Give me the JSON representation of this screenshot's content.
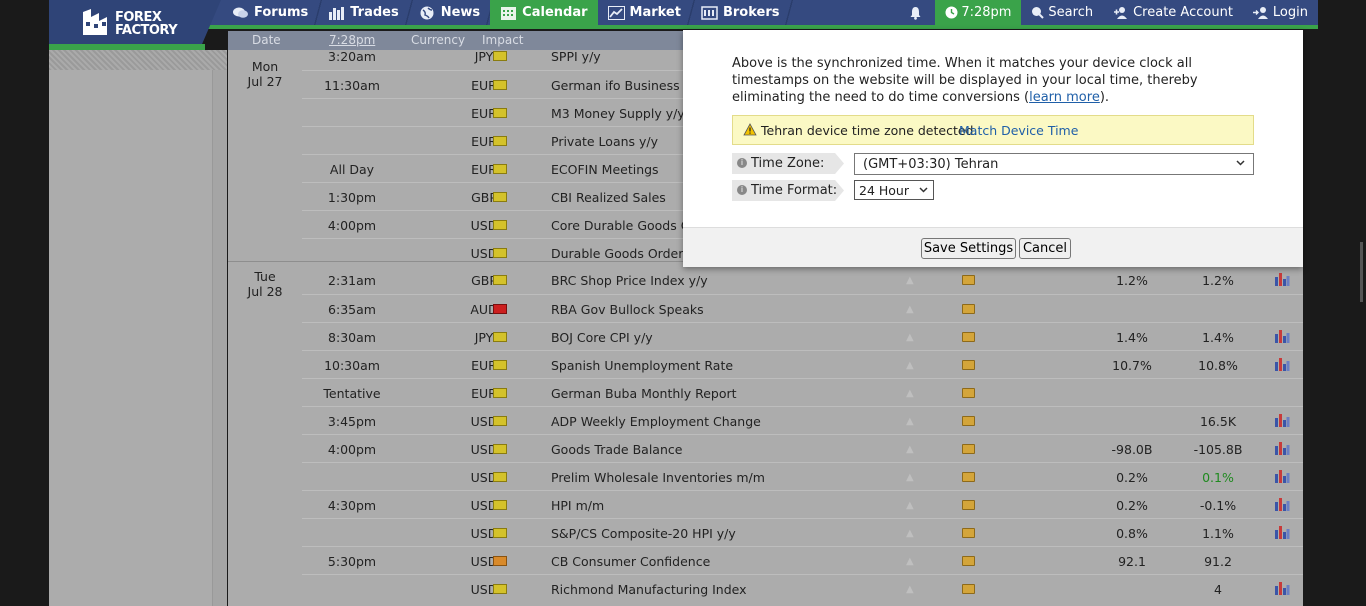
{
  "brand": {
    "line1": "FOREX",
    "line2": "FACTORY"
  },
  "nav": {
    "forums": "Forums",
    "trades": "Trades",
    "news": "News",
    "calendar": "Calendar",
    "market": "Market",
    "brokers": "Brokers"
  },
  "nav_right": {
    "time": "7:28pm",
    "search": "Search",
    "create_account": "Create Account",
    "login": "Login"
  },
  "calendar_header": {
    "date": "Date",
    "time": "7:28pm",
    "currency": "Currency",
    "impact": "Impact"
  },
  "days": [
    {
      "dow": "Mon",
      "date": "Jul 27"
    },
    {
      "dow": "Tue",
      "date": "Jul 28"
    }
  ],
  "rows": [
    {
      "time": "3:20am",
      "currency": "JPY",
      "impact": "low",
      "event": "SPPI y/y",
      "actual": "",
      "forecast": "",
      "chart": false
    },
    {
      "time": "11:30am",
      "currency": "EUR",
      "impact": "low",
      "event": "German ifo Business Cl",
      "actual": "",
      "forecast": "",
      "chart": false
    },
    {
      "time": "",
      "currency": "EUR",
      "impact": "low",
      "event": "M3 Money Supply y/y",
      "actual": "",
      "forecast": "",
      "chart": false
    },
    {
      "time": "",
      "currency": "EUR",
      "impact": "low",
      "event": "Private Loans y/y",
      "actual": "",
      "forecast": "",
      "chart": false
    },
    {
      "time": "All Day",
      "currency": "EUR",
      "impact": "low",
      "event": "ECOFIN Meetings",
      "actual": "",
      "forecast": "",
      "chart": false
    },
    {
      "time": "1:30pm",
      "currency": "GBP",
      "impact": "low",
      "event": "CBI Realized Sales",
      "actual": "",
      "forecast": "",
      "chart": false
    },
    {
      "time": "4:00pm",
      "currency": "USD",
      "impact": "low",
      "event": "Core Durable Goods Or",
      "actual": "",
      "forecast": "",
      "chart": false
    },
    {
      "time": "",
      "currency": "USD",
      "impact": "low",
      "event": "Durable Goods Orders r",
      "actual": "",
      "forecast": "",
      "chart": false
    },
    {
      "time": "2:31am",
      "currency": "GBP",
      "impact": "low",
      "event": "BRC Shop Price Index y/y",
      "actual": "1.2%",
      "forecast": "1.2%",
      "chart": true
    },
    {
      "time": "6:35am",
      "currency": "AUD",
      "impact": "high",
      "event": "RBA Gov Bullock Speaks",
      "actual": "",
      "forecast": "",
      "chart": false
    },
    {
      "time": "8:30am",
      "currency": "JPY",
      "impact": "low",
      "event": "BOJ Core CPI y/y",
      "actual": "1.4%",
      "forecast": "1.4%",
      "chart": true
    },
    {
      "time": "10:30am",
      "currency": "EUR",
      "impact": "low",
      "event": "Spanish Unemployment Rate",
      "actual": "10.7%",
      "forecast": "10.8%",
      "chart": true
    },
    {
      "time": "Tentative",
      "currency": "EUR",
      "impact": "low",
      "event": "German Buba Monthly Report",
      "actual": "",
      "forecast": "",
      "chart": false
    },
    {
      "time": "3:45pm",
      "currency": "USD",
      "impact": "low",
      "event": "ADP Weekly Employment Change",
      "actual": "",
      "forecast": "16.5K",
      "chart": true
    },
    {
      "time": "4:00pm",
      "currency": "USD",
      "impact": "low",
      "event": "Goods Trade Balance",
      "actual": "-98.0B",
      "forecast": "-105.8B",
      "chart": true
    },
    {
      "time": "",
      "currency": "USD",
      "impact": "low",
      "event": "Prelim Wholesale Inventories m/m",
      "actual": "0.2%",
      "forecast": "0.1%",
      "chart": true
    },
    {
      "time": "4:30pm",
      "currency": "USD",
      "impact": "low",
      "event": "HPI m/m",
      "actual": "0.2%",
      "forecast": "-0.1%",
      "chart": true
    },
    {
      "time": "",
      "currency": "USD",
      "impact": "low",
      "event": "S&P/CS Composite-20 HPI y/y",
      "actual": "0.8%",
      "forecast": "1.1%",
      "chart": true
    },
    {
      "time": "5:30pm",
      "currency": "USD",
      "impact": "medium",
      "event": "CB Consumer Confidence",
      "actual": "92.1",
      "forecast": "91.2",
      "chart": false
    },
    {
      "time": "",
      "currency": "USD",
      "impact": "low",
      "event": "Richmond Manufacturing Index",
      "actual": "",
      "forecast": "4",
      "chart": true
    }
  ],
  "modal": {
    "intro": "Above is the synchronized time. When it matches your device clock all timestamps on the website will be displayed in your local time, thereby eliminating the need to do time conversions (",
    "learn_more": "learn more",
    "intro_end": ").",
    "notice": "Tehran device time zone detected.",
    "match_link": "Match Device Time",
    "tz_label": "Time Zone:",
    "tz_value": "(GMT+03:30) Tehran",
    "tf_label": "Time Format:",
    "tf_value": "24 Hour",
    "save": "Save Settings",
    "cancel": "Cancel"
  },
  "colors": {
    "nav_bg": "#354a80",
    "accent_green": "#3aa34a",
    "impact_low": "#d4c22a",
    "impact_high": "#cc1f1f",
    "impact_medium": "#d98a2a",
    "better_value": "#1f8a1f"
  },
  "icons": {
    "forums": "chat-bubbles-icon",
    "trades": "bar-chart-icon",
    "news": "globe-icon",
    "calendar": "calendar-icon",
    "market": "line-chart-icon",
    "brokers": "building-icon",
    "notifications": "bell-icon",
    "clock": "clock-icon",
    "search": "search-icon",
    "create_account": "add-user-icon",
    "login": "login-icon"
  }
}
